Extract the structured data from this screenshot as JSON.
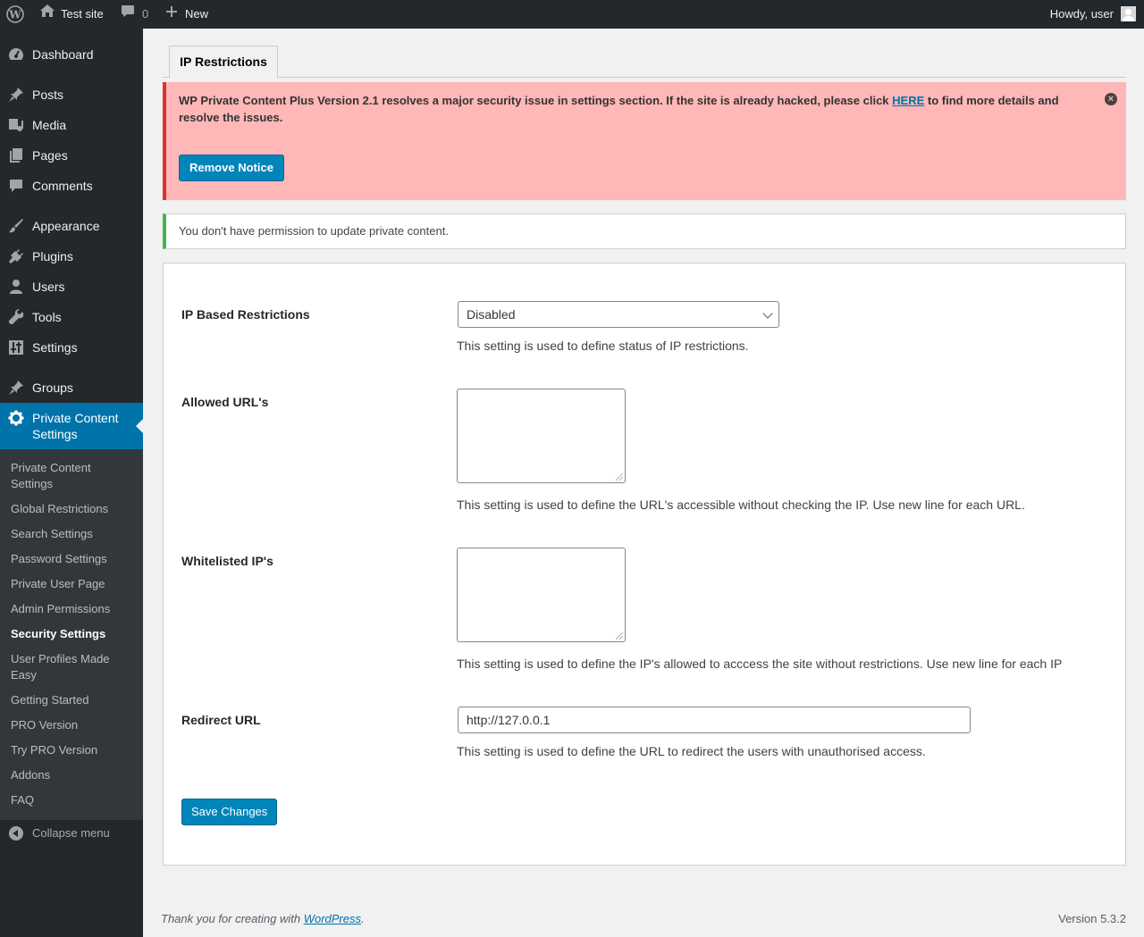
{
  "admin_bar": {
    "site_name": "Test site",
    "comments_count": "0",
    "new_label": "New",
    "howdy": "Howdy, user"
  },
  "sidebar": {
    "items": [
      {
        "label": "Dashboard",
        "icon": "dashboard-icon"
      },
      {
        "label": "Posts",
        "icon": "pin-icon"
      },
      {
        "label": "Media",
        "icon": "media-icon"
      },
      {
        "label": "Pages",
        "icon": "pages-icon"
      },
      {
        "label": "Comments",
        "icon": "comment-icon"
      },
      {
        "label": "Appearance",
        "icon": "brush-icon"
      },
      {
        "label": "Plugins",
        "icon": "plug-icon"
      },
      {
        "label": "Users",
        "icon": "user-icon"
      },
      {
        "label": "Tools",
        "icon": "wrench-icon"
      },
      {
        "label": "Settings",
        "icon": "sliders-icon"
      },
      {
        "label": "Groups",
        "icon": "pin-icon"
      },
      {
        "label": "Private Content Settings",
        "icon": "gear-icon"
      }
    ],
    "submenu": [
      "Private Content Settings",
      "Global Restrictions",
      "Search Settings",
      "Password Settings",
      "Private User Page",
      "Admin Permissions",
      "Security Settings",
      "User Profiles Made Easy",
      "Getting Started",
      "PRO Version",
      "Try PRO Version",
      "Addons",
      "FAQ"
    ],
    "collapse_label": "Collapse menu"
  },
  "tab": {
    "label": "IP Restrictions"
  },
  "error_notice": {
    "text_before": "WP Private Content Plus Version 2.1 resolves a major security issue in settings section. If the site is already hacked, please click ",
    "link_text": "HERE",
    "text_after": " to find more details and resolve the issues.",
    "button_label": "Remove Notice"
  },
  "success_notice": {
    "text": "You don't have permission to update private content."
  },
  "form": {
    "ip_restrictions": {
      "label": "IP Based Restrictions",
      "value": "Disabled",
      "description": "This setting is used to define status of IP restrictions."
    },
    "allowed_urls": {
      "label": "Allowed URL's",
      "value": "",
      "description": "This setting is used to define the URL's accessible without checking the IP. Use new line for each URL."
    },
    "whitelisted_ips": {
      "label": "Whitelisted IP's",
      "value": "",
      "description": "This setting is used to define the IP's allowed to acccess the site without restrictions. Use new line for each IP"
    },
    "redirect_url": {
      "label": "Redirect URL",
      "value": "http://127.0.0.1",
      "description": "This setting is used to define the URL to redirect the users with unauthorised access."
    },
    "save_label": "Save Changes"
  },
  "footer": {
    "thanks_before": "Thank you for creating with ",
    "thanks_link": "WordPress",
    "thanks_after": ".",
    "version": "Version 5.3.2"
  },
  "colors": {
    "admin_bar_bg": "#23282d",
    "accent": "#0073aa",
    "error_bg": "#ffb7b7",
    "error_border": "#dc3232",
    "success_border": "#46b450"
  }
}
